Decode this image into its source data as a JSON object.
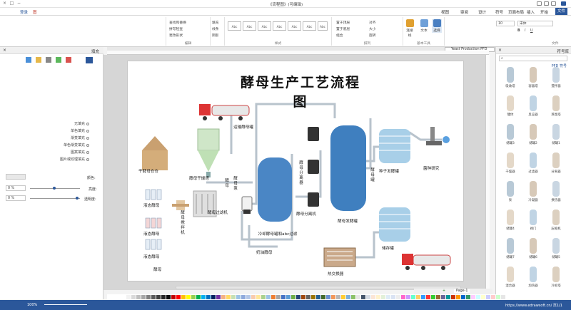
{
  "titlebar": {
    "title": "《流程图》(可编辑)"
  },
  "menubar": {
    "items": [
      {
        "label": "文件"
      },
      {
        "label": "开始"
      },
      {
        "label": "插入"
      },
      {
        "label": "页面布局"
      },
      {
        "label": "符号"
      },
      {
        "label": "帮助"
      },
      {
        "label": "设计"
      },
      {
        "label": "审阅"
      },
      {
        "label": "视图"
      }
    ],
    "right_items": [
      {
        "label": "登录"
      },
      {
        "label": "图"
      }
    ]
  },
  "ribbon": {
    "groups": [
      {
        "label": "文件"
      },
      {
        "label": "基本工具"
      },
      {
        "label": "排列"
      },
      {
        "label": "样式"
      },
      {
        "label": "编辑"
      }
    ],
    "font_name": "宋体",
    "font_size": "10",
    "tools": {
      "select": "选择",
      "text": "文本",
      "connector": "连接线"
    },
    "arrange": [
      "置于顶层",
      "置于底层",
      "组合",
      "对齐",
      "大小",
      "旋转"
    ],
    "style_boxes": [
      "Abc",
      "Abc",
      "Abc",
      "Abc",
      "Abc",
      "Abc",
      "Abc"
    ],
    "style_props": [
      "填充",
      "线条",
      "阴影"
    ],
    "edit": [
      "查找和替换",
      "拼写检查",
      "更改形状"
    ]
  },
  "left_panel": {
    "title": "填充",
    "fill_options": [
      "无填充",
      "单色填充",
      "渐变填充",
      "单色渐变填充",
      "图案填充",
      "图片或纹理填充"
    ],
    "color_label": "颜色:",
    "shade_label": "亮度:",
    "transparency_label": "透明度:",
    "shade_value": "0 %",
    "transparency_value": "0 %"
  },
  "document": {
    "tab_label": "Yeast Production PFD",
    "page_tab": "Page-1",
    "diagram_title": "酵母生产工艺流程图"
  },
  "diagram": {
    "labels": {
      "transport": "运输酵母罐",
      "dryer": "酵母干燥塔",
      "warehouse": "干酵母仓仓",
      "fermenter_big": "酵母发酵罐",
      "bioreactor": "种子发酵罐",
      "research": "菌种研究",
      "separator": "酵母分离机",
      "filter": "酵母过滤机",
      "liquid_a": "液态酵母",
      "liquid_b": "液态酵母",
      "liquid_c": "液态酵母",
      "cold_tank": "冷却酵母罐和abc过滤",
      "heat_exchanger": "热交换器",
      "storage": "储存罐",
      "cream": "奶油酵母",
      "lower_label": "酵母"
    },
    "vertical_labels": {
      "mixer": "酵母搅拌机",
      "pump": "酵母泵",
      "filter_press": "酵母分离器",
      "tank_right": "酵母罐",
      "small": "酵母"
    }
  },
  "right_panel": {
    "title": "符号库",
    "search_placeholder": "搜索",
    "section": "PFD 符号",
    "items": [
      {
        "label": "搅拌器"
      },
      {
        "label": "容器塔"
      },
      {
        "label": "吸收塔"
      },
      {
        "label": "蒸馏塔"
      },
      {
        "label": "反应器"
      },
      {
        "label": "罐体"
      },
      {
        "label": "储罐1"
      },
      {
        "label": "储罐2"
      },
      {
        "label": "储罐3"
      },
      {
        "label": "分离器"
      },
      {
        "label": "过滤器"
      },
      {
        "label": "干燥器"
      },
      {
        "label": "换热器"
      },
      {
        "label": "冷凝器"
      },
      {
        "label": "泵"
      },
      {
        "label": "压缩机"
      },
      {
        "label": "阀门"
      },
      {
        "label": "储罐4"
      },
      {
        "label": "储罐5"
      },
      {
        "label": "储罐6"
      },
      {
        "label": "储罐7"
      },
      {
        "label": "冷却塔"
      },
      {
        "label": "加热器"
      },
      {
        "label": "混合器"
      }
    ]
  },
  "statusbar": {
    "url": "https://www.edrawsoft.cn/ 页1/1",
    "zoom": "100%"
  },
  "palette_colors": [
    "#ffffff",
    "#f2f2f2",
    "#d9d9d9",
    "#bfbfbf",
    "#a6a6a6",
    "#7f7f7f",
    "#595959",
    "#3f3f3f",
    "#262626",
    "#0c0c0c",
    "#c00000",
    "#ff0000",
    "#ffc000",
    "#ffff00",
    "#92d050",
    "#00b050",
    "#00b0f0",
    "#0070c0",
    "#002060",
    "#7030a0",
    "#f4b183",
    "#ffd966",
    "#c5e0b4",
    "#9dc3e6",
    "#8faadc",
    "#b4c7e7",
    "#f8cbad",
    "#ffe699",
    "#a9d18e",
    "#9bc2e6",
    "#ed7d31",
    "#a5a5a5",
    "#4472c4",
    "#5b9bd5",
    "#70ad47",
    "#264478",
    "#9e480e",
    "#636363",
    "#997300",
    "#255e91",
    "#43682b",
    "#698ed0",
    "#f1975a",
    "#b7b7b7",
    "#ffcd33",
    "#7cafdd",
    "#8cc168",
    "#e7e6e6",
    "#44546a",
    "#d6dce5",
    "#fbe5d6",
    "#fff2cc",
    "#e2f0d9",
    "#deebf7",
    "#dae3f3",
    "#ededed",
    "#ff66cc",
    "#cc99ff",
    "#66ffcc",
    "#ffcc66",
    "#3399ff",
    "#ff3333",
    "#33cc33",
    "#996633",
    "#666699",
    "#009999",
    "#cc3300",
    "#ff9900",
    "#0066cc",
    "#339966",
    "#ffccff",
    "#ccffff",
    "#ffffcc",
    "#ccccff",
    "#ffcccc",
    "#ccffcc",
    "#e6e6e6"
  ]
}
